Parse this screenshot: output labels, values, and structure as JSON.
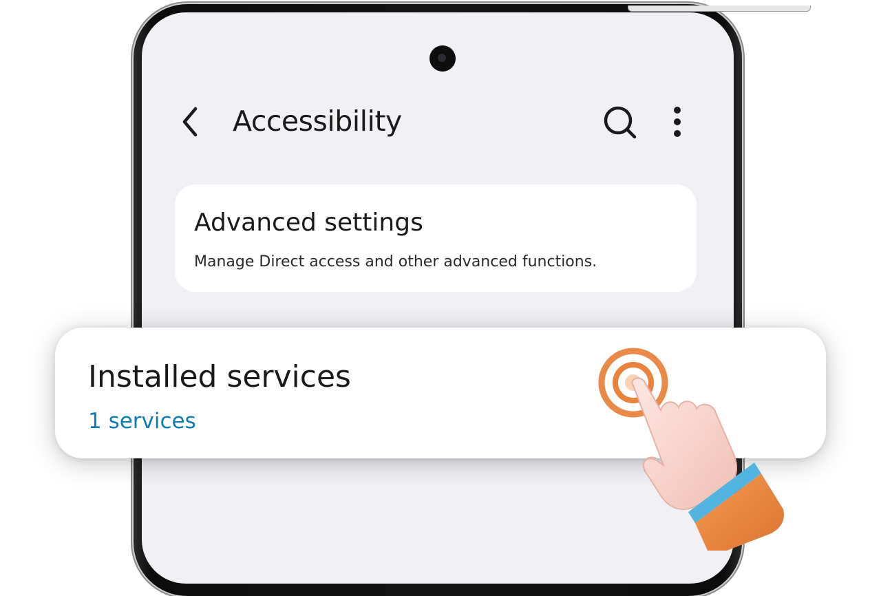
{
  "screen": {
    "title": "Accessibility",
    "icons": {
      "back": "back-arrow-icon",
      "search": "search-icon",
      "more": "more-vertical-icon"
    },
    "advanced_settings": {
      "title": "Advanced settings",
      "subtitle": "Manage Direct access and other advanced functions."
    }
  },
  "highlight": {
    "title": "Installed services",
    "subtitle": "1 services",
    "subtitle_color": "#0f7bb5"
  },
  "colors": {
    "screen_bg": "#f0f0f5",
    "card_bg": "#ffffff",
    "text": "#1a1a1a",
    "accent_blue": "#0f7bb5",
    "tap_ring": "#e8843e",
    "sleeve": "#ee8a44",
    "cuff": "#52b4e0"
  }
}
